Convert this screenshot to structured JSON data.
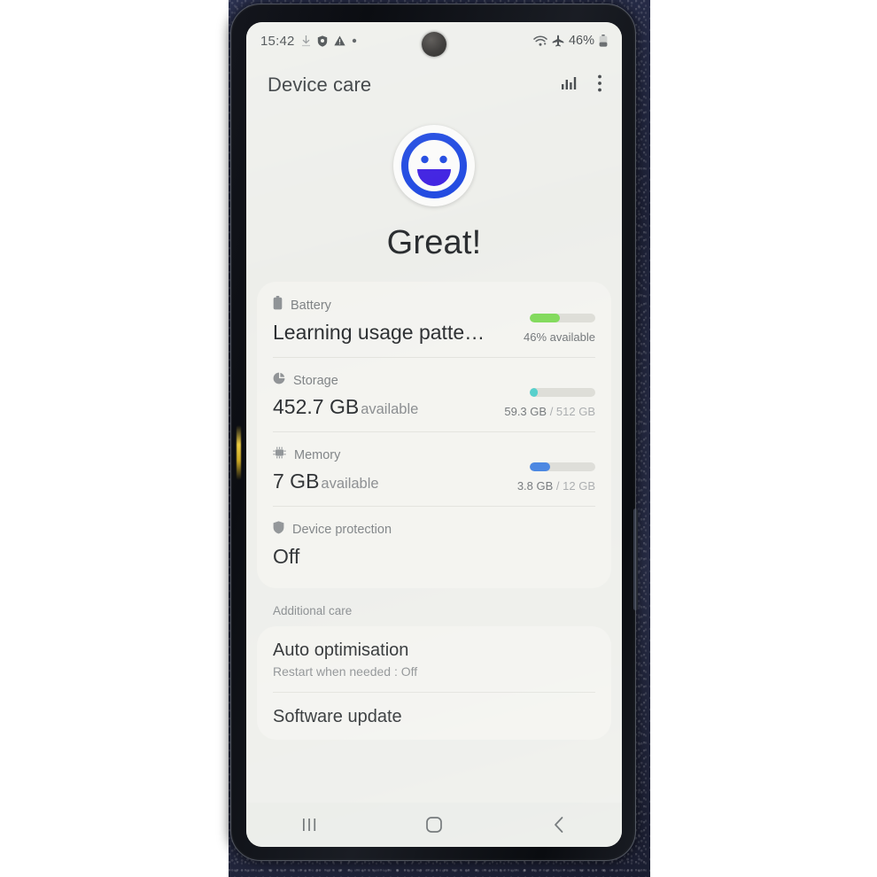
{
  "status_bar": {
    "time": "15:42",
    "left_icons": [
      "download-icon",
      "shield-icon",
      "warning-triangle-icon",
      "dot-icon"
    ],
    "right_icons": [
      "wifi-icon",
      "airplane-mode-icon",
      "battery-icon"
    ],
    "battery_percent": "46%"
  },
  "app_bar": {
    "title": "Device care",
    "chart_icon": "bar-chart-icon",
    "menu_icon": "more-options-icon"
  },
  "hero": {
    "face_icon": "smiley-face-icon",
    "status": "Great!",
    "accent_color": "#1a44e0"
  },
  "metrics": [
    {
      "icon": "battery-icon",
      "label": "Battery",
      "value": "Learning usage patterns…",
      "unit": "",
      "bar_percent": 46,
      "bar_color": "#7ed957",
      "sub": "46% available",
      "sub_muted": ""
    },
    {
      "icon": "storage-pie-icon",
      "label": "Storage",
      "value": "452.7 GB",
      "unit": "available",
      "bar_percent": 11.6,
      "bar_color": "#4ecdc9",
      "sub": "59.3 GB",
      "sub_muted": "/ 512 GB"
    },
    {
      "icon": "memory-chip-icon",
      "label": "Memory",
      "value": "7 GB",
      "unit": "available",
      "bar_percent": 31.7,
      "bar_color": "#3f7fe0",
      "sub": "3.8 GB",
      "sub_muted": "/ 12 GB"
    },
    {
      "icon": "shield-icon",
      "label": "Device protection",
      "value": "Off",
      "unit": "",
      "bar_percent": null,
      "bar_color": "",
      "sub": "",
      "sub_muted": ""
    }
  ],
  "additional_care": {
    "header": "Additional care",
    "items": [
      {
        "title": "Auto optimisation",
        "subtitle": "Restart when needed : Off"
      },
      {
        "title": "Software update",
        "subtitle": ""
      }
    ]
  },
  "nav_bar": {
    "recents": "recents-icon",
    "home": "home-icon",
    "back": "back-icon"
  }
}
